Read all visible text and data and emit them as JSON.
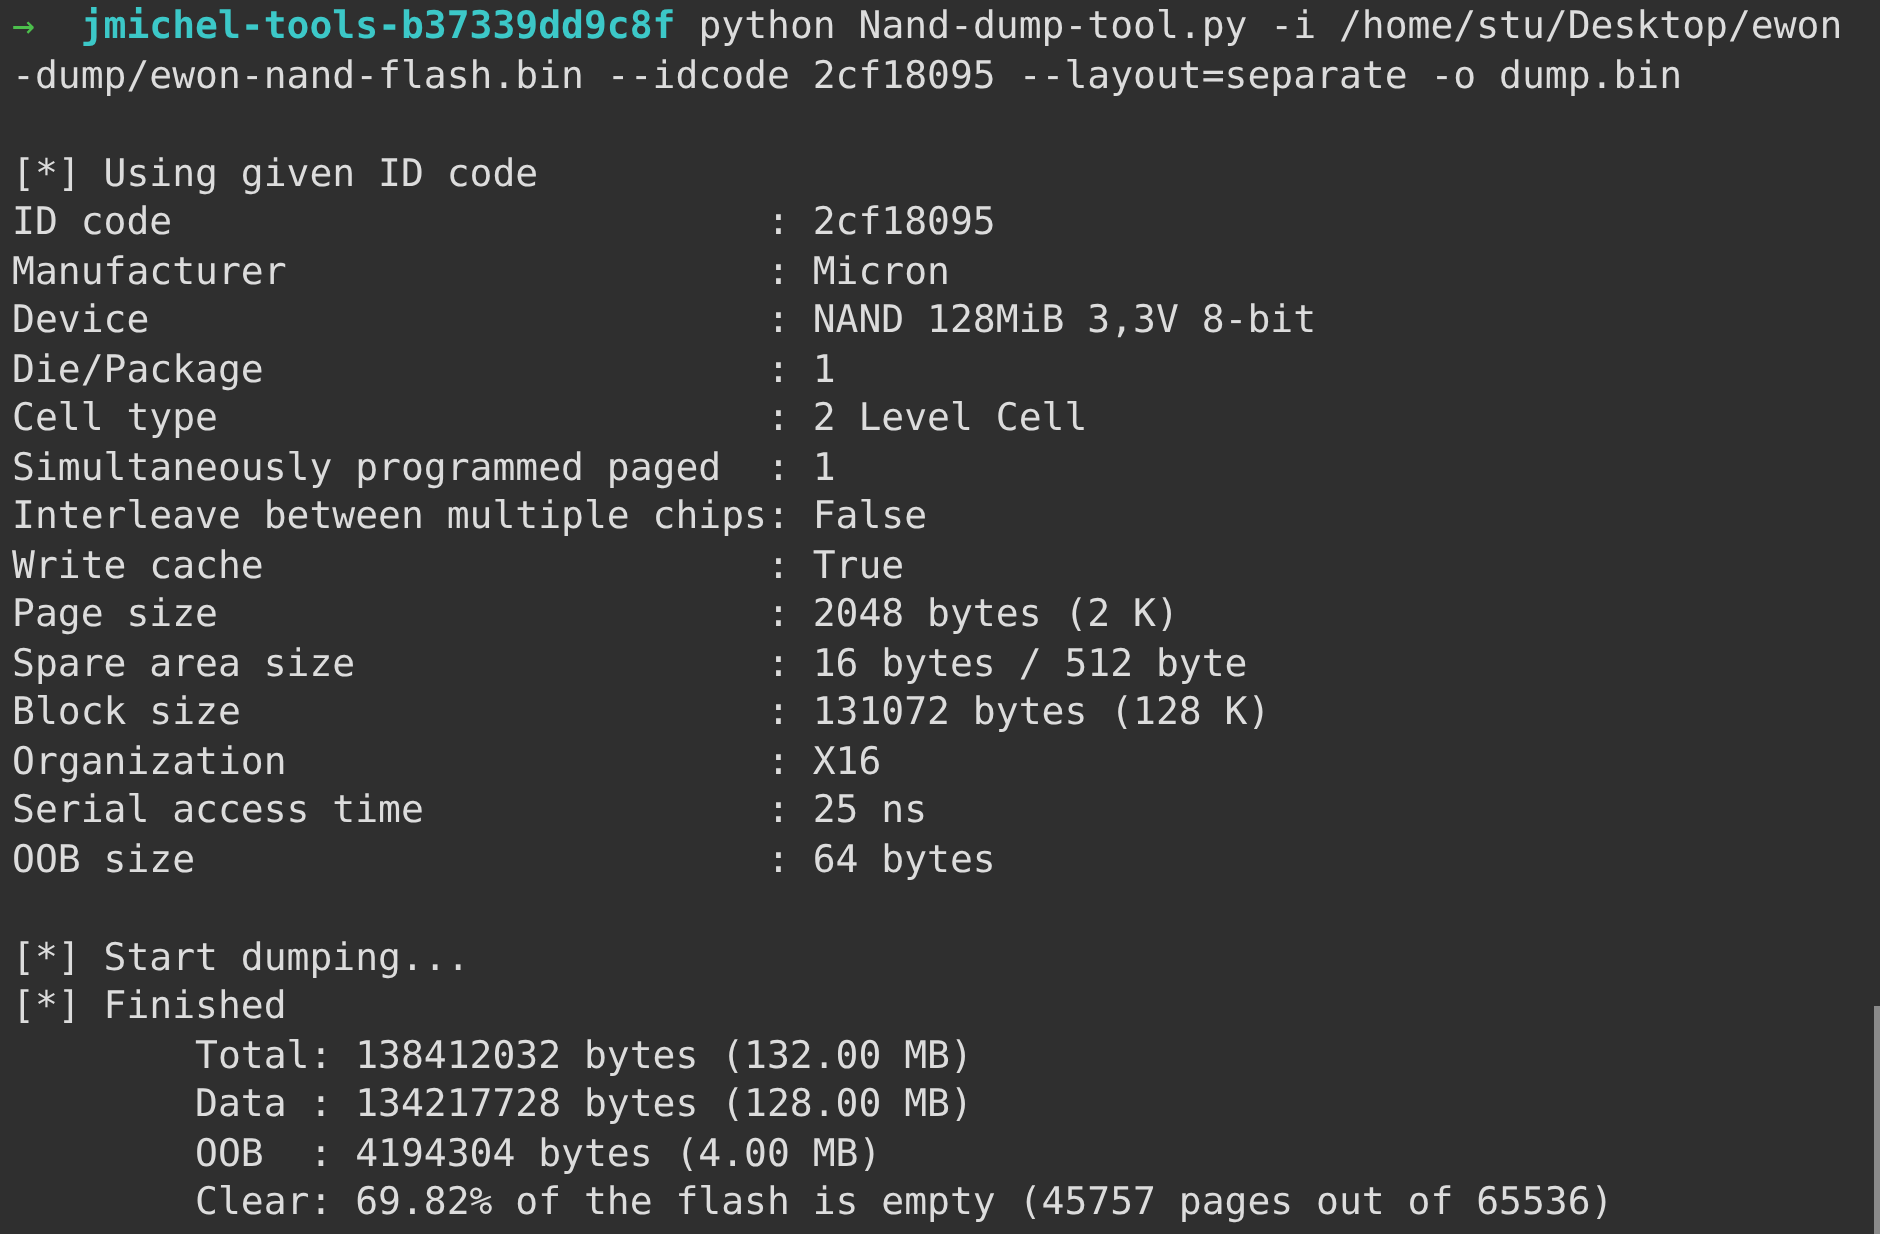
{
  "terminal": {
    "lines": [
      {
        "kind": "prompt",
        "arrow": "→",
        "directory": "jmichel-tools-b37339dd9c8f",
        "command": "python Nand-dump-tool.py -i /home/stu/Desktop/ewon"
      },
      {
        "kind": "text",
        "text": "-dump/ewon-nand-flash.bin --idcode 2cf18095 --layout=separate -o dump.bin"
      },
      {
        "kind": "blank"
      },
      {
        "kind": "text",
        "text": "[*] Using given ID code"
      },
      {
        "kind": "text",
        "text": "ID code                          : 2cf18095"
      },
      {
        "kind": "text",
        "text": "Manufacturer                     : Micron"
      },
      {
        "kind": "text",
        "text": "Device                           : NAND 128MiB 3,3V 8-bit"
      },
      {
        "kind": "text",
        "text": "Die/Package                      : 1"
      },
      {
        "kind": "text",
        "text": "Cell type                        : 2 Level Cell"
      },
      {
        "kind": "text",
        "text": "Simultaneously programmed paged  : 1"
      },
      {
        "kind": "text",
        "text": "Interleave between multiple chips: False"
      },
      {
        "kind": "text",
        "text": "Write cache                      : True"
      },
      {
        "kind": "text",
        "text": "Page size                        : 2048 bytes (2 K)"
      },
      {
        "kind": "text",
        "text": "Spare area size                  : 16 bytes / 512 byte"
      },
      {
        "kind": "text",
        "text": "Block size                       : 131072 bytes (128 K)"
      },
      {
        "kind": "text",
        "text": "Organization                     : X16"
      },
      {
        "kind": "text",
        "text": "Serial access time               : 25 ns"
      },
      {
        "kind": "text",
        "text": "OOB size                         : 64 bytes"
      },
      {
        "kind": "blank"
      },
      {
        "kind": "text",
        "text": "[*] Start dumping..."
      },
      {
        "kind": "text",
        "text": "[*] Finished"
      },
      {
        "kind": "text",
        "text": "        Total: 138412032 bytes (132.00 MB)"
      },
      {
        "kind": "text",
        "text": "        Data : 134217728 bytes (128.00 MB)"
      },
      {
        "kind": "text",
        "text": "        OOB  : 4194304 bytes (4.00 MB)"
      },
      {
        "kind": "text",
        "text": "        Clear: 69.82% of the flash is empty (45757 pages out of 65536)"
      }
    ]
  }
}
